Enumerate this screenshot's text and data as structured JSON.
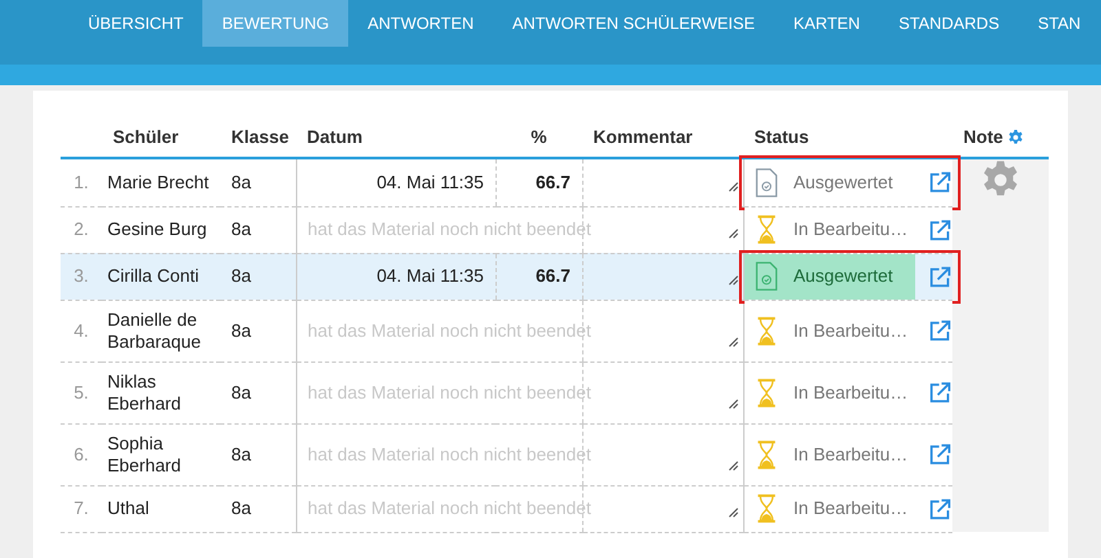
{
  "tabs": [
    {
      "label": "ÜBERSICHT",
      "selected": false
    },
    {
      "label": "BEWERTUNG",
      "selected": true
    },
    {
      "label": "ANTWORTEN",
      "selected": false
    },
    {
      "label": "ANTWORTEN SCHÜLERWEISE",
      "selected": false
    },
    {
      "label": "KARTEN",
      "selected": false
    },
    {
      "label": "STANDARDS",
      "selected": false
    },
    {
      "label": "STAN",
      "selected": false
    }
  ],
  "table": {
    "columns": [
      "Schüler",
      "Klasse",
      "Datum",
      "%",
      "Kommentar",
      "Status",
      "Note"
    ],
    "rows": [
      {
        "number": "1.",
        "name": "Marie Brecht",
        "class": "8a",
        "kind": "finished",
        "date": "04. Mai 11:35",
        "percent": "66.7",
        "selected": false,
        "status": {
          "kind": "evaluated",
          "label": "Ausgewertet",
          "marked": true
        },
        "note_settings": true
      },
      {
        "number": "2.",
        "name": "Gesine Burg",
        "class": "8a",
        "kind": "unfinished",
        "message": "hat das Material noch nicht beendet",
        "selected": false,
        "status": {
          "kind": "in_progress",
          "label": "In Bearbeitu…",
          "marked": false
        },
        "note_settings": false
      },
      {
        "number": "3.",
        "name": "Cirilla Conti",
        "class": "8a",
        "kind": "finished",
        "date": "04. Mai 11:35",
        "percent": "66.7",
        "selected": true,
        "status": {
          "kind": "evaluated",
          "label": "Ausgewertet",
          "marked": true
        },
        "note_settings": false
      },
      {
        "number": "4.",
        "name": "Danielle de Barbaraque",
        "class": "8a",
        "kind": "unfinished",
        "message": "hat das Material noch nicht beendet",
        "selected": false,
        "status": {
          "kind": "in_progress",
          "label": "In Bearbeitu…",
          "marked": false
        },
        "note_settings": false
      },
      {
        "number": "5.",
        "name": "Niklas Eberhard",
        "class": "8a",
        "kind": "unfinished",
        "message": "hat das Material noch nicht beendet",
        "selected": false,
        "status": {
          "kind": "in_progress",
          "label": "In Bearbeitu…",
          "marked": false
        },
        "note_settings": false
      },
      {
        "number": "6.",
        "name": "Sophia Eberhard",
        "class": "8a",
        "kind": "unfinished",
        "message": "hat das Material noch nicht beendet",
        "selected": false,
        "status": {
          "kind": "in_progress",
          "label": "In Bearbeitu…",
          "marked": false
        },
        "note_settings": false
      },
      {
        "number": "7.",
        "name": "Uthal",
        "class": "8a",
        "kind": "unfinished",
        "message": "hat das Material noch nicht beendet",
        "selected": false,
        "status": {
          "kind": "in_progress",
          "label": "In Bearbeitu…",
          "marked": false
        },
        "note_settings": false
      }
    ]
  }
}
